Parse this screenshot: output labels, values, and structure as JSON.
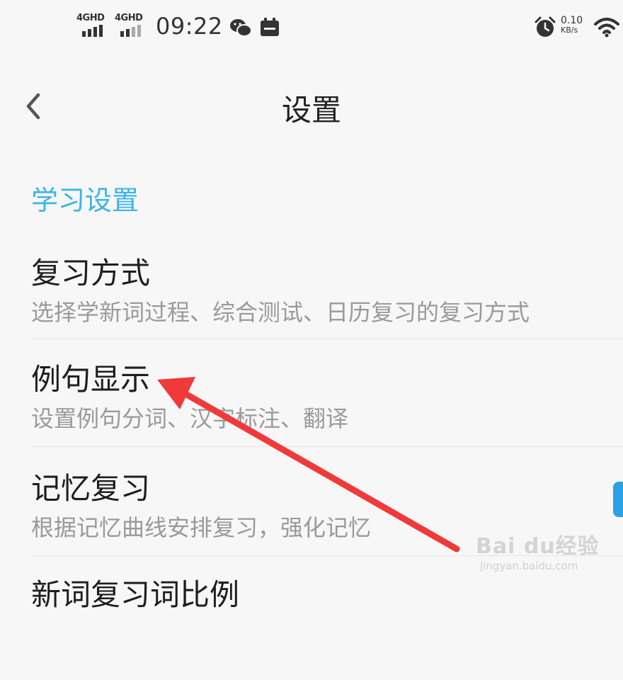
{
  "status_bar": {
    "signal_1_label": "4GHD",
    "signal_2_label": "4GHD",
    "time": "09:22",
    "net_speed_value": "0.10",
    "net_speed_unit": "KB/s"
  },
  "header": {
    "title": "设置"
  },
  "section": {
    "title": "学习设置"
  },
  "items": [
    {
      "title": "复习方式",
      "desc": "选择学新词过程、综合测试、日历复习的复习方式"
    },
    {
      "title": "例句显示",
      "desc": "设置例句分词、汉字标注、翻译"
    },
    {
      "title": "记忆复习",
      "desc": "根据记忆曲线安排复习，强化记忆"
    },
    {
      "title": "新词复习词比例",
      "desc": ""
    }
  ],
  "watermark": {
    "brand": "Bai du经验",
    "sub": "jingyan.baidu.com"
  },
  "colors": {
    "accent": "#3db4e8",
    "arrow": "#f03a3a",
    "handle": "#29a3e6"
  }
}
